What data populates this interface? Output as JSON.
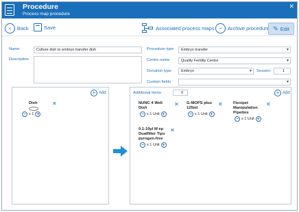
{
  "window": {
    "title": "Procedure",
    "subtitle": "Process map procedure",
    "close": "✕"
  },
  "toolbar": {
    "back": "Back",
    "save": "Save",
    "associated": "Associated process maps",
    "archive": "Archive procedure",
    "edit": "Edit"
  },
  "form": {
    "name_label": "Name",
    "name_value": "Culture dish to embryo transfer dish",
    "description_label": "Description",
    "procedure_type_label": "Procedure type",
    "procedure_type_value": "Embryo transfer",
    "centre_label": "Centre name",
    "centre_value": "Quality Fertility Centre",
    "donation_label": "Donation type",
    "donation_value": "Embryo",
    "session_label": "Session",
    "session_value": "1",
    "custom_label": "Custom fields"
  },
  "left_panel": {
    "add": "Add",
    "items": [
      {
        "name": "Dish",
        "qty": "x 1"
      }
    ]
  },
  "right_panel": {
    "additional_label": "Additional items",
    "additional_value": "0",
    "add": "Add",
    "items": [
      {
        "name": "NUNC 4 Well Dish",
        "qty": "x 1 Unit"
      },
      {
        "name": "G-MOPS plus 125ml",
        "qty": "x 1 Unit"
      },
      {
        "name": "Flexipet Manipulation Pipettes",
        "qty": "x 1 Unit"
      },
      {
        "name": "0.1-10µl M ep Dualfilter Tips pyrogen-free",
        "qty": "x 1 Unit"
      }
    ]
  },
  "colors": {
    "accent": "#1a6fba",
    "arrow": "#1f8fd8"
  }
}
